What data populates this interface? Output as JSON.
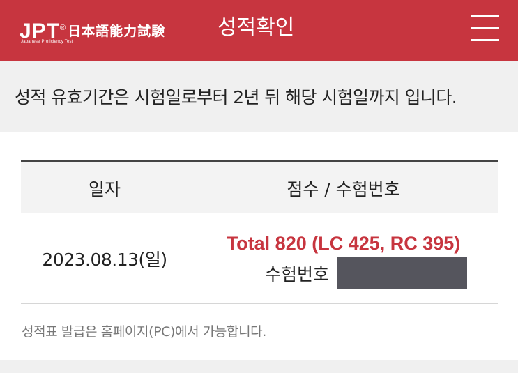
{
  "header": {
    "logo": {
      "main": "JPT",
      "mark": "®",
      "kanji": "日本語能力試験",
      "sub": "Japanese Proficiency Test"
    },
    "title": "성적확인",
    "menu_icon": "hamburger-menu-icon",
    "background_color": "#c7353f"
  },
  "notice": {
    "text": "성적 유효기간은 시험일로부터 2년 뒤 해당 시험일까지 입니다."
  },
  "table": {
    "headers": {
      "date": "일자",
      "score": "점수 / 수험번호"
    },
    "rows": [
      {
        "date": "2023.08.13(일)",
        "score_total": "Total 820 (LC 425, RC 395)",
        "exam_label": "수험번호"
      }
    ],
    "accent_color": "#c7353f"
  },
  "footnote": {
    "text": "성적표 발급은 홈페이지(PC)에서 가능합니다."
  }
}
